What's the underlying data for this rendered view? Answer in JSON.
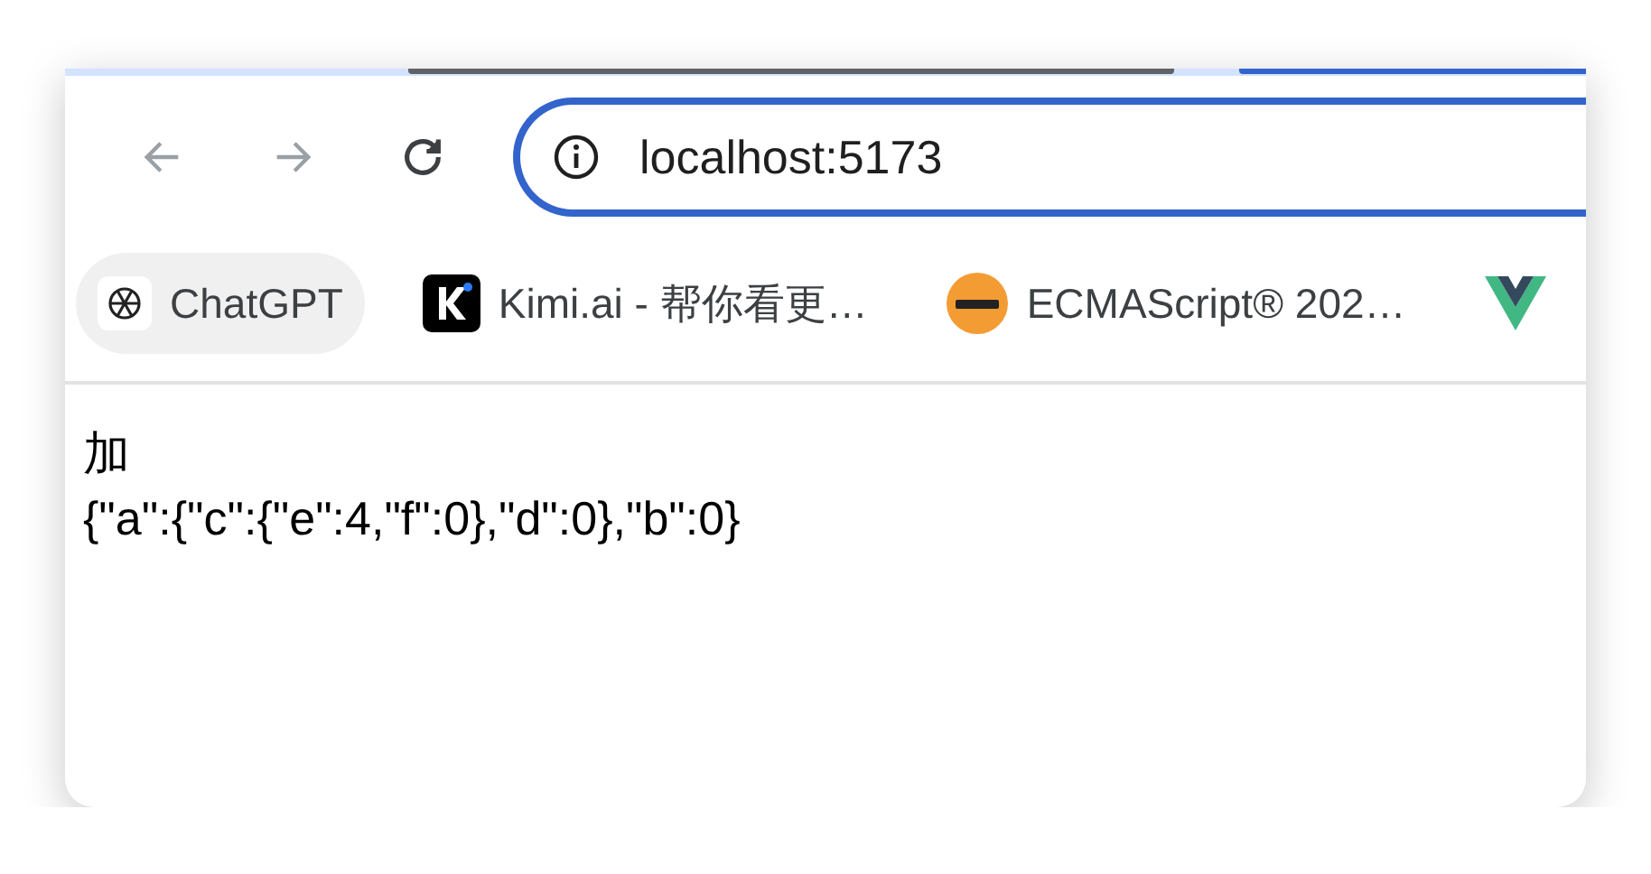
{
  "toolbar": {
    "buttons": [
      {
        "kind": "back",
        "disabled": true
      },
      {
        "kind": "forward",
        "disabled": true
      },
      {
        "kind": "reload",
        "disabled": false
      }
    ],
    "address": {
      "value": "localhost:5173"
    }
  },
  "bookmarks": [
    {
      "label": "ChatGPT",
      "kind": "chatgpt",
      "selected": true
    },
    {
      "label": "Kimi.ai - 帮你看更…",
      "kind": "kimi",
      "selected": false
    },
    {
      "label": "ECMAScript® 202…",
      "kind": "ecma",
      "selected": false
    },
    {
      "kind": "vue",
      "selected": false
    }
  ],
  "content": {
    "lines": [
      "加",
      "{\"a\":{\"c\":{\"e\":4,\"f\":0},\"d\":0},\"b\":0}"
    ]
  }
}
